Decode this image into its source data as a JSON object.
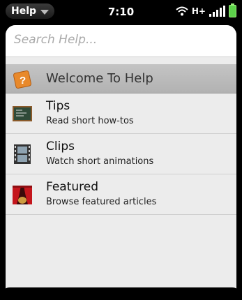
{
  "status_bar": {
    "app_name": "Help",
    "time": "7:10",
    "network": "H+"
  },
  "search": {
    "placeholder": "Search Help..."
  },
  "list": {
    "welcome": {
      "label": "Welcome To Help"
    },
    "items": [
      {
        "title": "Tips",
        "subtitle": "Read short how-tos",
        "icon": "chalkboard-icon"
      },
      {
        "title": "Clips",
        "subtitle": "Watch short animations",
        "icon": "film-strip-icon"
      },
      {
        "title": "Featured",
        "subtitle": "Browse featured articles",
        "icon": "stage-curtain-icon"
      }
    ]
  },
  "colors": {
    "welcome_icon": "#e8892b",
    "battery": "#5cd14a"
  }
}
